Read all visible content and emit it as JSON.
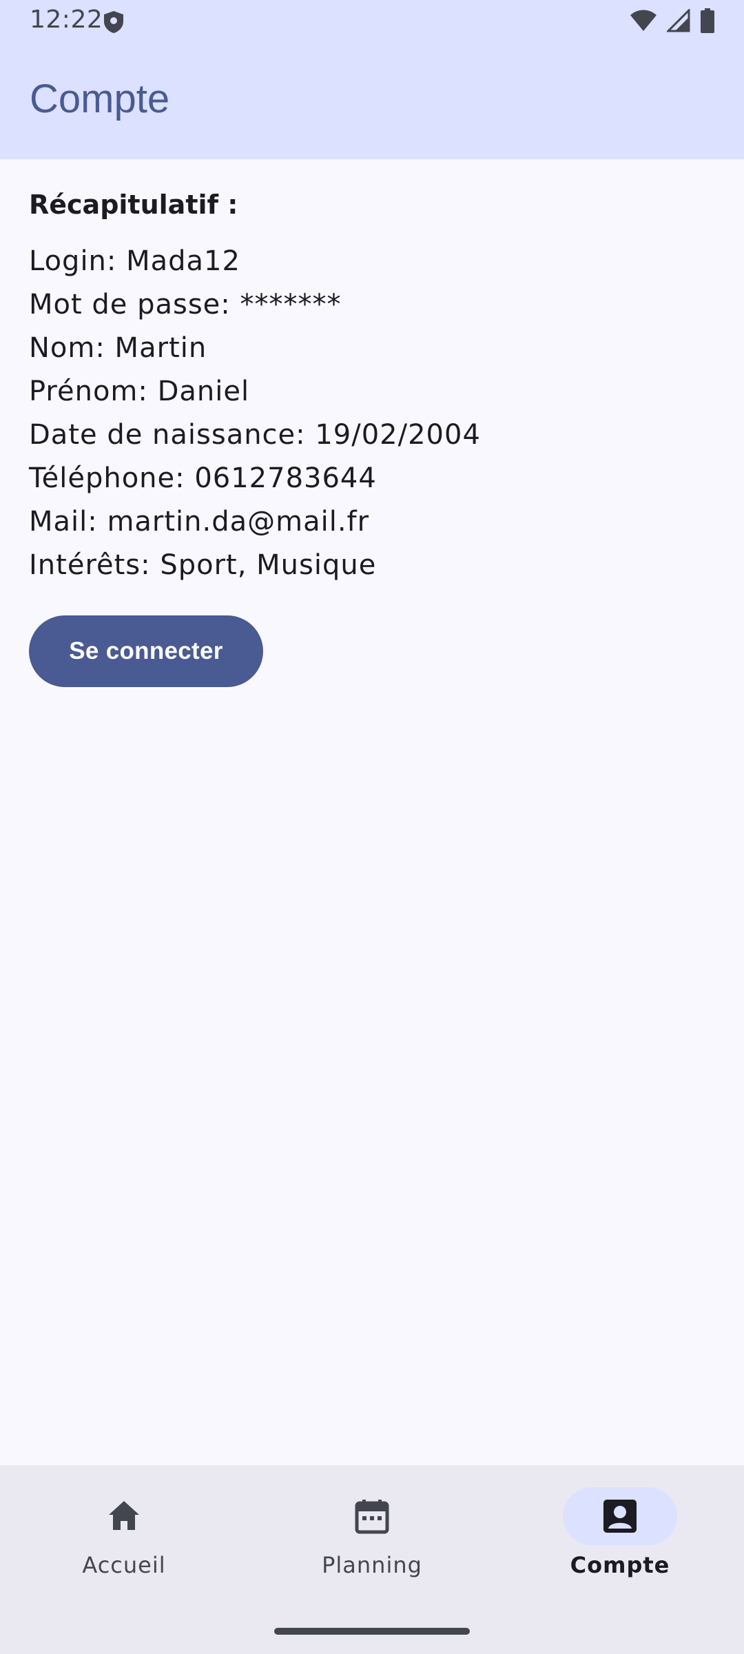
{
  "status_bar": {
    "time": "12:22",
    "icons": [
      "shield-icon",
      "wifi-icon",
      "signal-icon",
      "battery-icon"
    ]
  },
  "app_bar": {
    "title": "Compte"
  },
  "summary": {
    "heading": "Récapitulatif :",
    "lines": [
      "Login: Mada12",
      "Mot de passe: *******",
      "Nom: Martin",
      "Prénom: Daniel",
      "Date de naissance: 19/02/2004",
      "Téléphone: 0612783644",
      "Mail: martin.da@mail.fr",
      "Intérêts: Sport, Musique"
    ]
  },
  "connect_button": {
    "label": "Se connecter"
  },
  "bottom_nav": {
    "items": [
      {
        "label": "Accueil",
        "icon": "home-icon",
        "selected": false
      },
      {
        "label": "Planning",
        "icon": "calendar-icon",
        "selected": false
      },
      {
        "label": "Compte",
        "icon": "account-box-icon",
        "selected": true
      }
    ]
  },
  "colors": {
    "top_bar_background": "#dbe1ff",
    "primary": "#4a5a92",
    "page_background": "#f9f8ff",
    "nav_background": "#eae9f2",
    "nav_indicator": "#dbe1ff"
  }
}
